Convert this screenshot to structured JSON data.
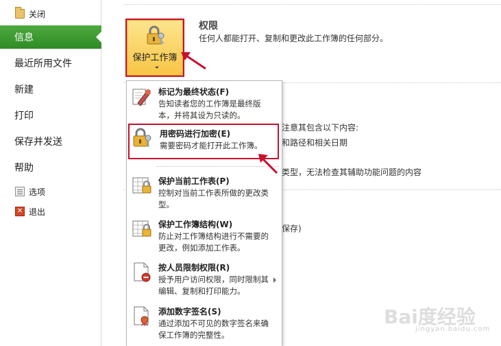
{
  "sidebar": {
    "close_label": "关闭",
    "items": [
      {
        "label": "信息",
        "active": true
      },
      {
        "label": "最近所用文件"
      },
      {
        "label": "新建"
      },
      {
        "label": "打印"
      },
      {
        "label": "保存并发送"
      },
      {
        "label": "帮助"
      }
    ],
    "options_label": "选项",
    "exit_label": "退出"
  },
  "main": {
    "protect_button_label": "保护工作簿",
    "permissions_title": "权限",
    "permissions_desc": "任何人都能打开、复制和更改此工作簿的任何部分。",
    "bg_text_1": "注意其包含以下内容:",
    "bg_text_2": "和路径和相关日期",
    "bg_text_3": "类型，无法检查其辅助功能问题的内容",
    "bg_text_4": "保存)"
  },
  "dropdown": {
    "items": [
      {
        "title": "标记为最终状态(F)",
        "desc": "告知读者您的工作簿是最终版本，并将其设为只读的。",
        "icon": "mark-final-icon"
      },
      {
        "title": "用密码进行加密(E)",
        "desc": "需要密码才能打开此工作簿。",
        "icon": "lock-key-icon",
        "highlighted": true
      },
      {
        "title": "保护当前工作表(P)",
        "desc": "控制对当前工作表所做的更改类型。",
        "icon": "sheet-lock-icon"
      },
      {
        "title": "保护工作簿结构(W)",
        "desc": "防止对工作簿结构进行不需要的更改，例如添加工作表。",
        "icon": "workbook-lock-icon"
      },
      {
        "title": "按人员限制权限(R)",
        "desc": "授予用户访问权限，同时限制其编辑、复制和打印能力。",
        "icon": "restrict-permission-icon",
        "has_submenu": true
      },
      {
        "title": "添加数字签名(S)",
        "desc": "通过添加不可见的数字签名来确保工作簿的完整性。",
        "icon": "digital-signature-icon"
      }
    ]
  },
  "watermark": {
    "text": "Bai度经验",
    "sub": "jingyan.baidu.com"
  },
  "colors": {
    "active_green": "#3a9a2e",
    "highlight_red": "#c8102e",
    "button_gold": "#f8c545"
  }
}
